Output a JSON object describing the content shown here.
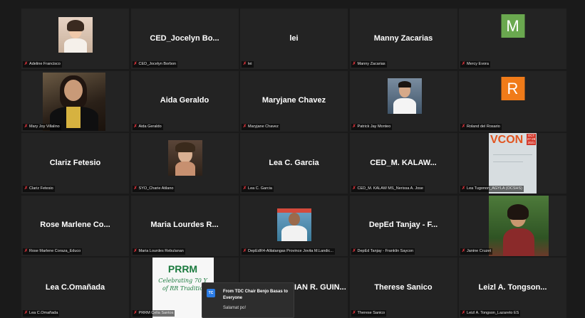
{
  "participants": [
    {
      "display": "",
      "label": "Adeline Francisco"
    },
    {
      "display": "CED_Jocelyn   Bo...",
      "label": "CED_Jocelyn  Borbon"
    },
    {
      "display": "lei",
      "label": "lei"
    },
    {
      "display": "Manny Zacarias",
      "label": "Manny Zacarias"
    },
    {
      "display": "",
      "label": "Mercy Evora",
      "avatar_letter": "M",
      "avatar_color": "#6aa84f"
    },
    {
      "display": "",
      "label": "Mary Joy Villalino"
    },
    {
      "display": "Aida Geraldo",
      "label": "Aida Geraldo"
    },
    {
      "display": "Maryjane Chavez",
      "label": "Maryjane Chavez"
    },
    {
      "display": "",
      "label": "Patrick Jay Monteo"
    },
    {
      "display": "",
      "label": "Roland del Rosario",
      "avatar_letter": "R",
      "avatar_color": "#f07b19"
    },
    {
      "display": "Clariz Fetesio",
      "label": "Clariz Fetesio"
    },
    {
      "display": "",
      "label": "SYO_Charie Atilano"
    },
    {
      "display": "Lea C. Garcia",
      "label": "Lea C. Garcia"
    },
    {
      "display": "CED_M. KALAW...",
      "label": "CED_M. KALAW MS_Nerissa  A. Jose"
    },
    {
      "display": "",
      "label": "Lea Tugonon_AGYLA (OCSHS)",
      "vcon_text": "VCON",
      "vcon_date": "OCT 27-29 2021"
    },
    {
      "display": "Rose Marlene Co...",
      "label": "Rose Marlene Coraza_Educo"
    },
    {
      "display": "Maria Lourdes R...",
      "label": "Maria Lourdes Rebulanan"
    },
    {
      "display": "",
      "label": "DepEdR4-Alilatangas Province Jovita M.Landic..."
    },
    {
      "display": "DepEd Tanjay - F...",
      "label": "DepEd Tanjay - Franklin Saycon"
    },
    {
      "display": "",
      "label": "Janine Cruzet"
    },
    {
      "display": "Lea C.Omañada",
      "label": "Lea C.Omañada"
    },
    {
      "display": "",
      "label": "PRRM Celia Santos",
      "prrm_title": "PRRM",
      "prrm_sub1": "Celebrating 70 Y",
      "prrm_sub2": "of RR Traditio"
    },
    {
      "display": "ADRIAN R. GUIN...",
      "label": ""
    },
    {
      "display": "Therese Sanico",
      "label": "Therese Sanico"
    },
    {
      "display": "Leizl  A. Tongson...",
      "label": "Leizl A. Tongson_Lazareto ES"
    }
  ],
  "chat": {
    "initials": "TC",
    "from": "From TDC Chair Benjo Basas to Everyone",
    "message": "Salamat po!"
  },
  "colors": {
    "muted_mic": "#e0323a",
    "tile_bg": "#232323",
    "background": "#1a1a1a"
  },
  "icons": {
    "muted": "muted-mic-icon"
  }
}
